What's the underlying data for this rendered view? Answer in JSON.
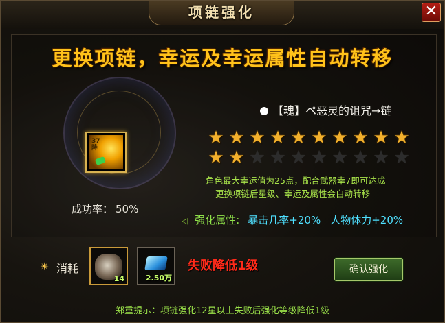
{
  "window": {
    "title": "项链强化",
    "close_label": "✕"
  },
  "headline": "更换项链，幸运及幸运属性自动转移",
  "item": {
    "name": "【魂】ペ恶灵的诅咒→链",
    "badge": "37\n降"
  },
  "success": {
    "label": "成功率：",
    "value": "50%"
  },
  "stars": {
    "filled": 12,
    "total": 20,
    "glyph": "★"
  },
  "info": {
    "line1": "角色最大幸运值为25点，配合武器幸7即可达成",
    "line2": "更换项链后星级、幸运及属性会自动转移"
  },
  "attributes": {
    "label": "强化属性:",
    "values": [
      "暴击几率+20%",
      "人物体力+20%"
    ]
  },
  "cost": {
    "label": "消耗",
    "materials": [
      {
        "icon": "ore-bag-icon",
        "count": "14"
      },
      {
        "icon": "diamond-icon",
        "count": "2.50万"
      }
    ],
    "fail_text": "失败降低1级",
    "confirm_label": "确认强化"
  },
  "footer": "郑重提示：项链强化12星以上失败后强化等级降低1级",
  "colors": {
    "gold": "#ffc21a",
    "star": "#f2b02c",
    "green": "#a8e34a",
    "cyan": "#4fe0ff",
    "red": "#ff2a1a"
  }
}
